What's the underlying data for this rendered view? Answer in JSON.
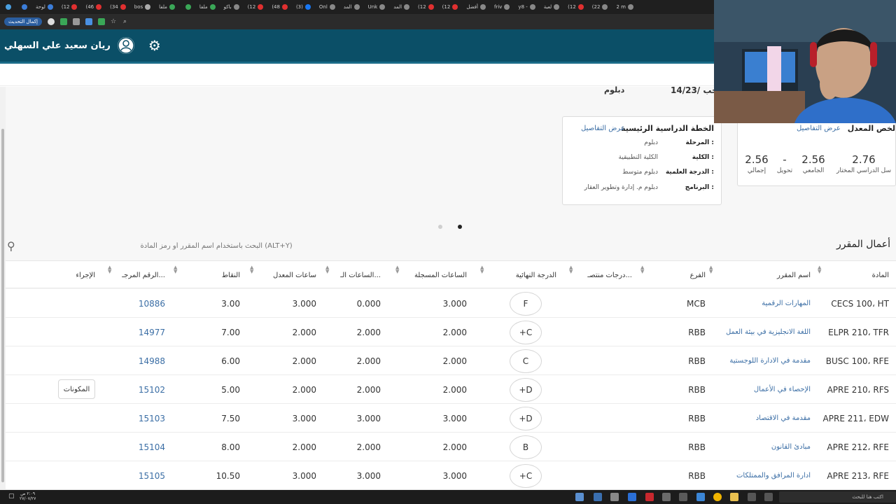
{
  "browser": {
    "tabs": [
      {
        "label": "",
        "color": "#4a9fe0"
      },
      {
        "label": "",
        "color": "#3b7dd8"
      },
      {
        "label": "لوحة",
        "color": "#3b7dd8"
      },
      {
        "label": "(12",
        "color": "#e03030"
      },
      {
        "label": "(46",
        "color": "#e03030"
      },
      {
        "label": "(34",
        "color": "#e03030"
      },
      {
        "label": "bos",
        "color": "#aaaaaa"
      },
      {
        "label": "ملفا",
        "color": "#3aa757"
      },
      {
        "label": "",
        "color": "#3aa757"
      },
      {
        "label": "ملفا",
        "color": "#3aa757"
      },
      {
        "label": "باكو",
        "color": "#888888"
      },
      {
        "label": "(12",
        "color": "#e03030"
      },
      {
        "label": "(48",
        "color": "#e03030"
      },
      {
        "label": "(3)",
        "color": "#1877f2"
      },
      {
        "label": "Onl",
        "color": "#888888"
      },
      {
        "label": "المد",
        "color": "#888888"
      },
      {
        "label": "Unk",
        "color": "#888888"
      },
      {
        "label": "المد",
        "color": "#888888"
      },
      {
        "label": "(12",
        "color": "#e03030"
      },
      {
        "label": "(12",
        "color": "#e03030"
      },
      {
        "label": "أفضل",
        "color": "#888888"
      },
      {
        "label": "friv",
        "color": "#888888"
      },
      {
        "label": "y8 -",
        "color": "#888888"
      },
      {
        "label": "لعبة",
        "color": "#888888"
      },
      {
        "label": "(12",
        "color": "#e03030"
      },
      {
        "label": "(22",
        "color": "#888888"
      },
      {
        "label": "2 m",
        "color": "#888888"
      }
    ],
    "update_label": "إكمال التحديث"
  },
  "header": {
    "user_name": "ريان سعيد علي السهلي",
    "settings_icon": "gear-icon",
    "avatar_icon": "user-avatar-icon"
  },
  "summary": {
    "date_text": "14/رجب /23",
    "diploma_text": "دبلوم"
  },
  "plan": {
    "title": "الخطة الدراسية الرئيسية",
    "details_link": "عرض التفاصيل",
    "rows": [
      {
        "key": "المرحلة :",
        "value": "دبلوم"
      },
      {
        "key": "الكلية :",
        "value": "الكلية التطبيقية"
      },
      {
        "key": "الدرجة العلمية :",
        "value": "دبلوم متوسط"
      },
      {
        "key": "البرنامج :",
        "value": "دبلوم م. إدارة وتطوير العقار"
      }
    ]
  },
  "gpa": {
    "title": "لخص المعدل",
    "details_link": "عرض التفاصيل",
    "items": [
      {
        "value": "2.76",
        "label": "سل الدراسي المختار"
      },
      {
        "value": "2.56",
        "label": "الجامعي"
      },
      {
        "value": "-",
        "label": "تحويل"
      },
      {
        "value": "2.56",
        "label": "إجمالي"
      }
    ]
  },
  "courses": {
    "section_title": "أعمال المقرر",
    "search_placeholder": "البحث باستخدام اسم المقرر أو رمز المادة (ALT+Y)",
    "columns": {
      "subject": "المادة",
      "name": "اسم المقرر",
      "branch": "الفرع",
      "mid_grades": "درجات منتصـ...",
      "final_grade": "الدرجة النهائية",
      "registered_hours": "الساعات المسجلة",
      "earned_hours": "الساعات الـ...",
      "gpa_hours": "ساعات المعدل",
      "points": "النقاط",
      "ref_number": "الرقم المرجـ...",
      "action": "الإجراء"
    },
    "rows": [
      {
        "subject": "CECS 100، HT",
        "name": "المهارات الرقمية",
        "branch": "MCB",
        "grade": "F",
        "reg": "3.000",
        "earned": "0.000",
        "gpa_hours": "3.000",
        "points": "3.00",
        "ref": "10886",
        "action": ""
      },
      {
        "subject": "ELPR 210، TFR",
        "name": "اللغة الانجليزية في بيئة العمل",
        "branch": "RBB",
        "grade": "+C",
        "reg": "2.000",
        "earned": "2.000",
        "gpa_hours": "2.000",
        "points": "7.00",
        "ref": "14977",
        "action": ""
      },
      {
        "subject": "BUSC 100، RFE",
        "name": "مقدمة في الادارة اللوجستية",
        "branch": "RBB",
        "grade": "C",
        "reg": "2.000",
        "earned": "2.000",
        "gpa_hours": "2.000",
        "points": "6.00",
        "ref": "14988",
        "action": ""
      },
      {
        "subject": "APRE 210، RFS",
        "name": "الإحصاء في الأعمال",
        "branch": "RBB",
        "grade": "+D",
        "reg": "2.000",
        "earned": "2.000",
        "gpa_hours": "2.000",
        "points": "5.00",
        "ref": "15102",
        "action": "المكونات"
      },
      {
        "subject": "APRE 211، EDW",
        "name": "مقدمة في الاقتصاد",
        "branch": "RBB",
        "grade": "+D",
        "reg": "3.000",
        "earned": "3.000",
        "gpa_hours": "3.000",
        "points": "7.50",
        "ref": "15103",
        "action": ""
      },
      {
        "subject": "APRE 212، RFE",
        "name": "مبادئ القانون",
        "branch": "RBB",
        "grade": "B",
        "reg": "2.000",
        "earned": "2.000",
        "gpa_hours": "2.000",
        "points": "8.00",
        "ref": "15104",
        "action": ""
      },
      {
        "subject": "APRE 213، RFE",
        "name": "ادارة المرافق والممتلكات",
        "branch": "RBB",
        "grade": "+C",
        "reg": "3.000",
        "earned": "3.000",
        "gpa_hours": "3.000",
        "points": "10.50",
        "ref": "15105",
        "action": ""
      }
    ]
  },
  "taskbar": {
    "search_placeholder": "اكتب هنا للبحث",
    "clock_time": "٢:٠٩ ص",
    "clock_date": "٢٧/٠٧/٢٧"
  }
}
